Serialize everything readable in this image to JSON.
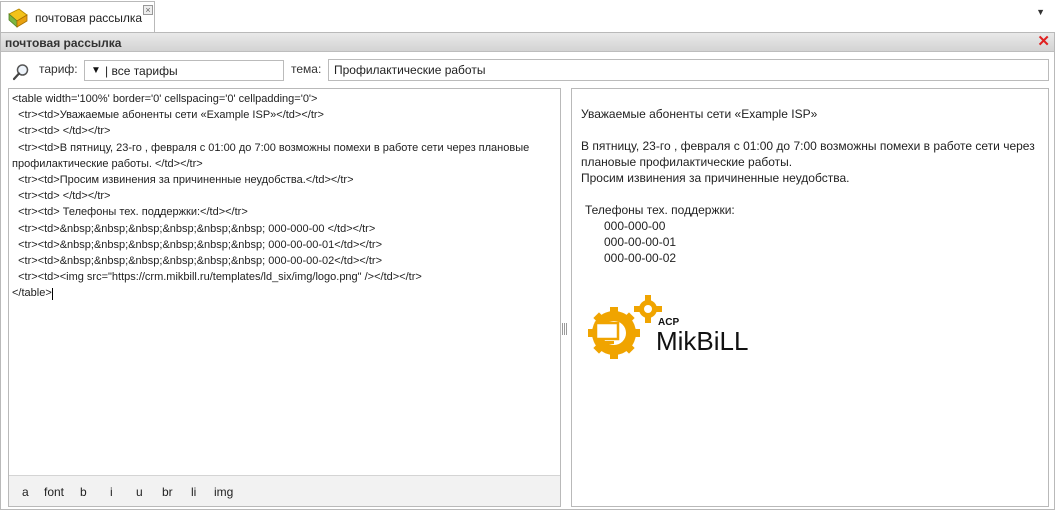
{
  "tab": {
    "label": "почтовая рассылка",
    "close_glyph": "×",
    "menu_glyph": "▼"
  },
  "panel": {
    "title": "почтовая рассылка",
    "close_glyph": "✕"
  },
  "toolbar": {
    "tariff_label": "тариф:",
    "tariff_value": "| все тарифы",
    "tariff_arrow": "▼",
    "subject_label": "тема:",
    "subject_value": "Профилактические работы"
  },
  "editor": {
    "code": "<table width='100%' border='0' cellspacing='0' cellpadding='0'>\n  <tr><td>Уважаемые абоненты сети «Example ISP»</td></tr>\n  <tr><td> </td></tr>\n  <tr><td>В пятницу, 23-го , февраля с 01:00 до 7:00 возможны помехи в работе сети через плановые профилактические работы. </td></tr>\n  <tr><td>Просим извинения за причиненные неудобства.</td></tr>\n  <tr><td> </td></tr>\n  <tr><td> Телефоны тех. поддержки:</td></tr>\n  <tr><td>&nbsp;&nbsp;&nbsp;&nbsp;&nbsp;&nbsp; 000-000-00 </td></tr>\n  <tr><td>&nbsp;&nbsp;&nbsp;&nbsp;&nbsp;&nbsp; 000-00-00-01</td></tr>\n  <tr><td>&nbsp;&nbsp;&nbsp;&nbsp;&nbsp;&nbsp; 000-00-00-02</td></tr>\n  <tr><td><img src=\"https://crm.mikbill.ru/templates/ld_six/img/logo.png\" /></td></tr>\n</table>",
    "buttons": [
      "a",
      "font",
      "b",
      "i",
      "u",
      "br",
      "li",
      "img"
    ]
  },
  "preview": {
    "greeting": "Уважаемые абоненты сети «Example ISP»",
    "body_line1": "В пятницу, 23-го , февраля с 01:00 до 7:00 возможны помехи в работе сети через",
    "body_line2": "плановые профилактические работы.",
    "apology": "Просим извинения за причиненные неудобства.",
    "support_label": "Телефоны тех. поддержки:",
    "phones": [
      "000-000-00",
      "000-00-00-01",
      "000-00-00-02"
    ],
    "logo": {
      "acp": "ACP",
      "name": "MikBiLL"
    }
  },
  "colors": {
    "logo_orange": "#f0a400",
    "close_red": "#e02020",
    "header_gray": "#d8d8d8"
  }
}
